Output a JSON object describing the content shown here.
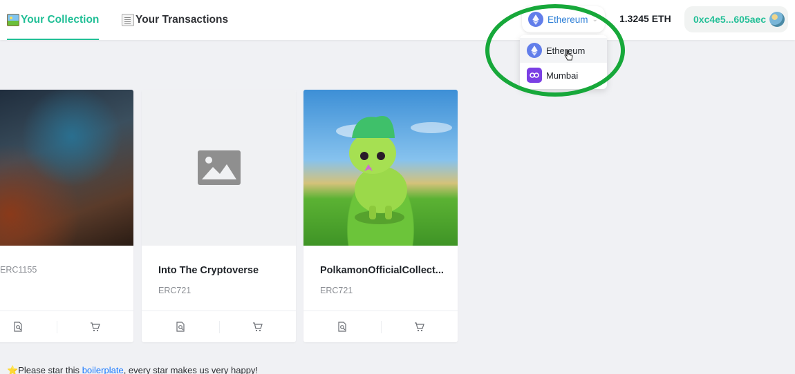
{
  "header": {
    "tabs": [
      {
        "label": "Your Collection",
        "icon": "framed-picture-icon",
        "active": true
      },
      {
        "label": "Your Transactions",
        "icon": "page-icon",
        "active": false
      }
    ],
    "network": {
      "selected": "Ethereum",
      "icon": "ethereum-icon"
    },
    "balance": "1.3245 ETH",
    "wallet": {
      "address": "0xc4e5...605aec",
      "icon": "avatar-icon"
    }
  },
  "network_dropdown": {
    "options": [
      {
        "label": "Ethereum",
        "icon": "ethereum-icon",
        "hovered": true
      },
      {
        "label": "Mumbai",
        "icon": "polygon-icon",
        "hovered": false
      }
    ]
  },
  "cards": [
    {
      "title": "",
      "standard": "ERC1155",
      "image": "cyberpunk-chef-artwork"
    },
    {
      "title": "Into The Cryptoverse",
      "standard": "ERC721",
      "image": "placeholder-icon"
    },
    {
      "title": "PolkamonOfficialCollect...",
      "standard": "ERC721",
      "image": "green-unicorn-creature-artwork"
    }
  ],
  "footer": {
    "prefix": "Please star this ",
    "link": "boilerplate",
    "suffix": ", every star makes us very happy!"
  },
  "colors": {
    "accent": "#21bf96",
    "link": "#1677ff",
    "annotation_circle": "#17a83a",
    "ethereum": "#627eea",
    "polygon": "#7b3fe4"
  }
}
